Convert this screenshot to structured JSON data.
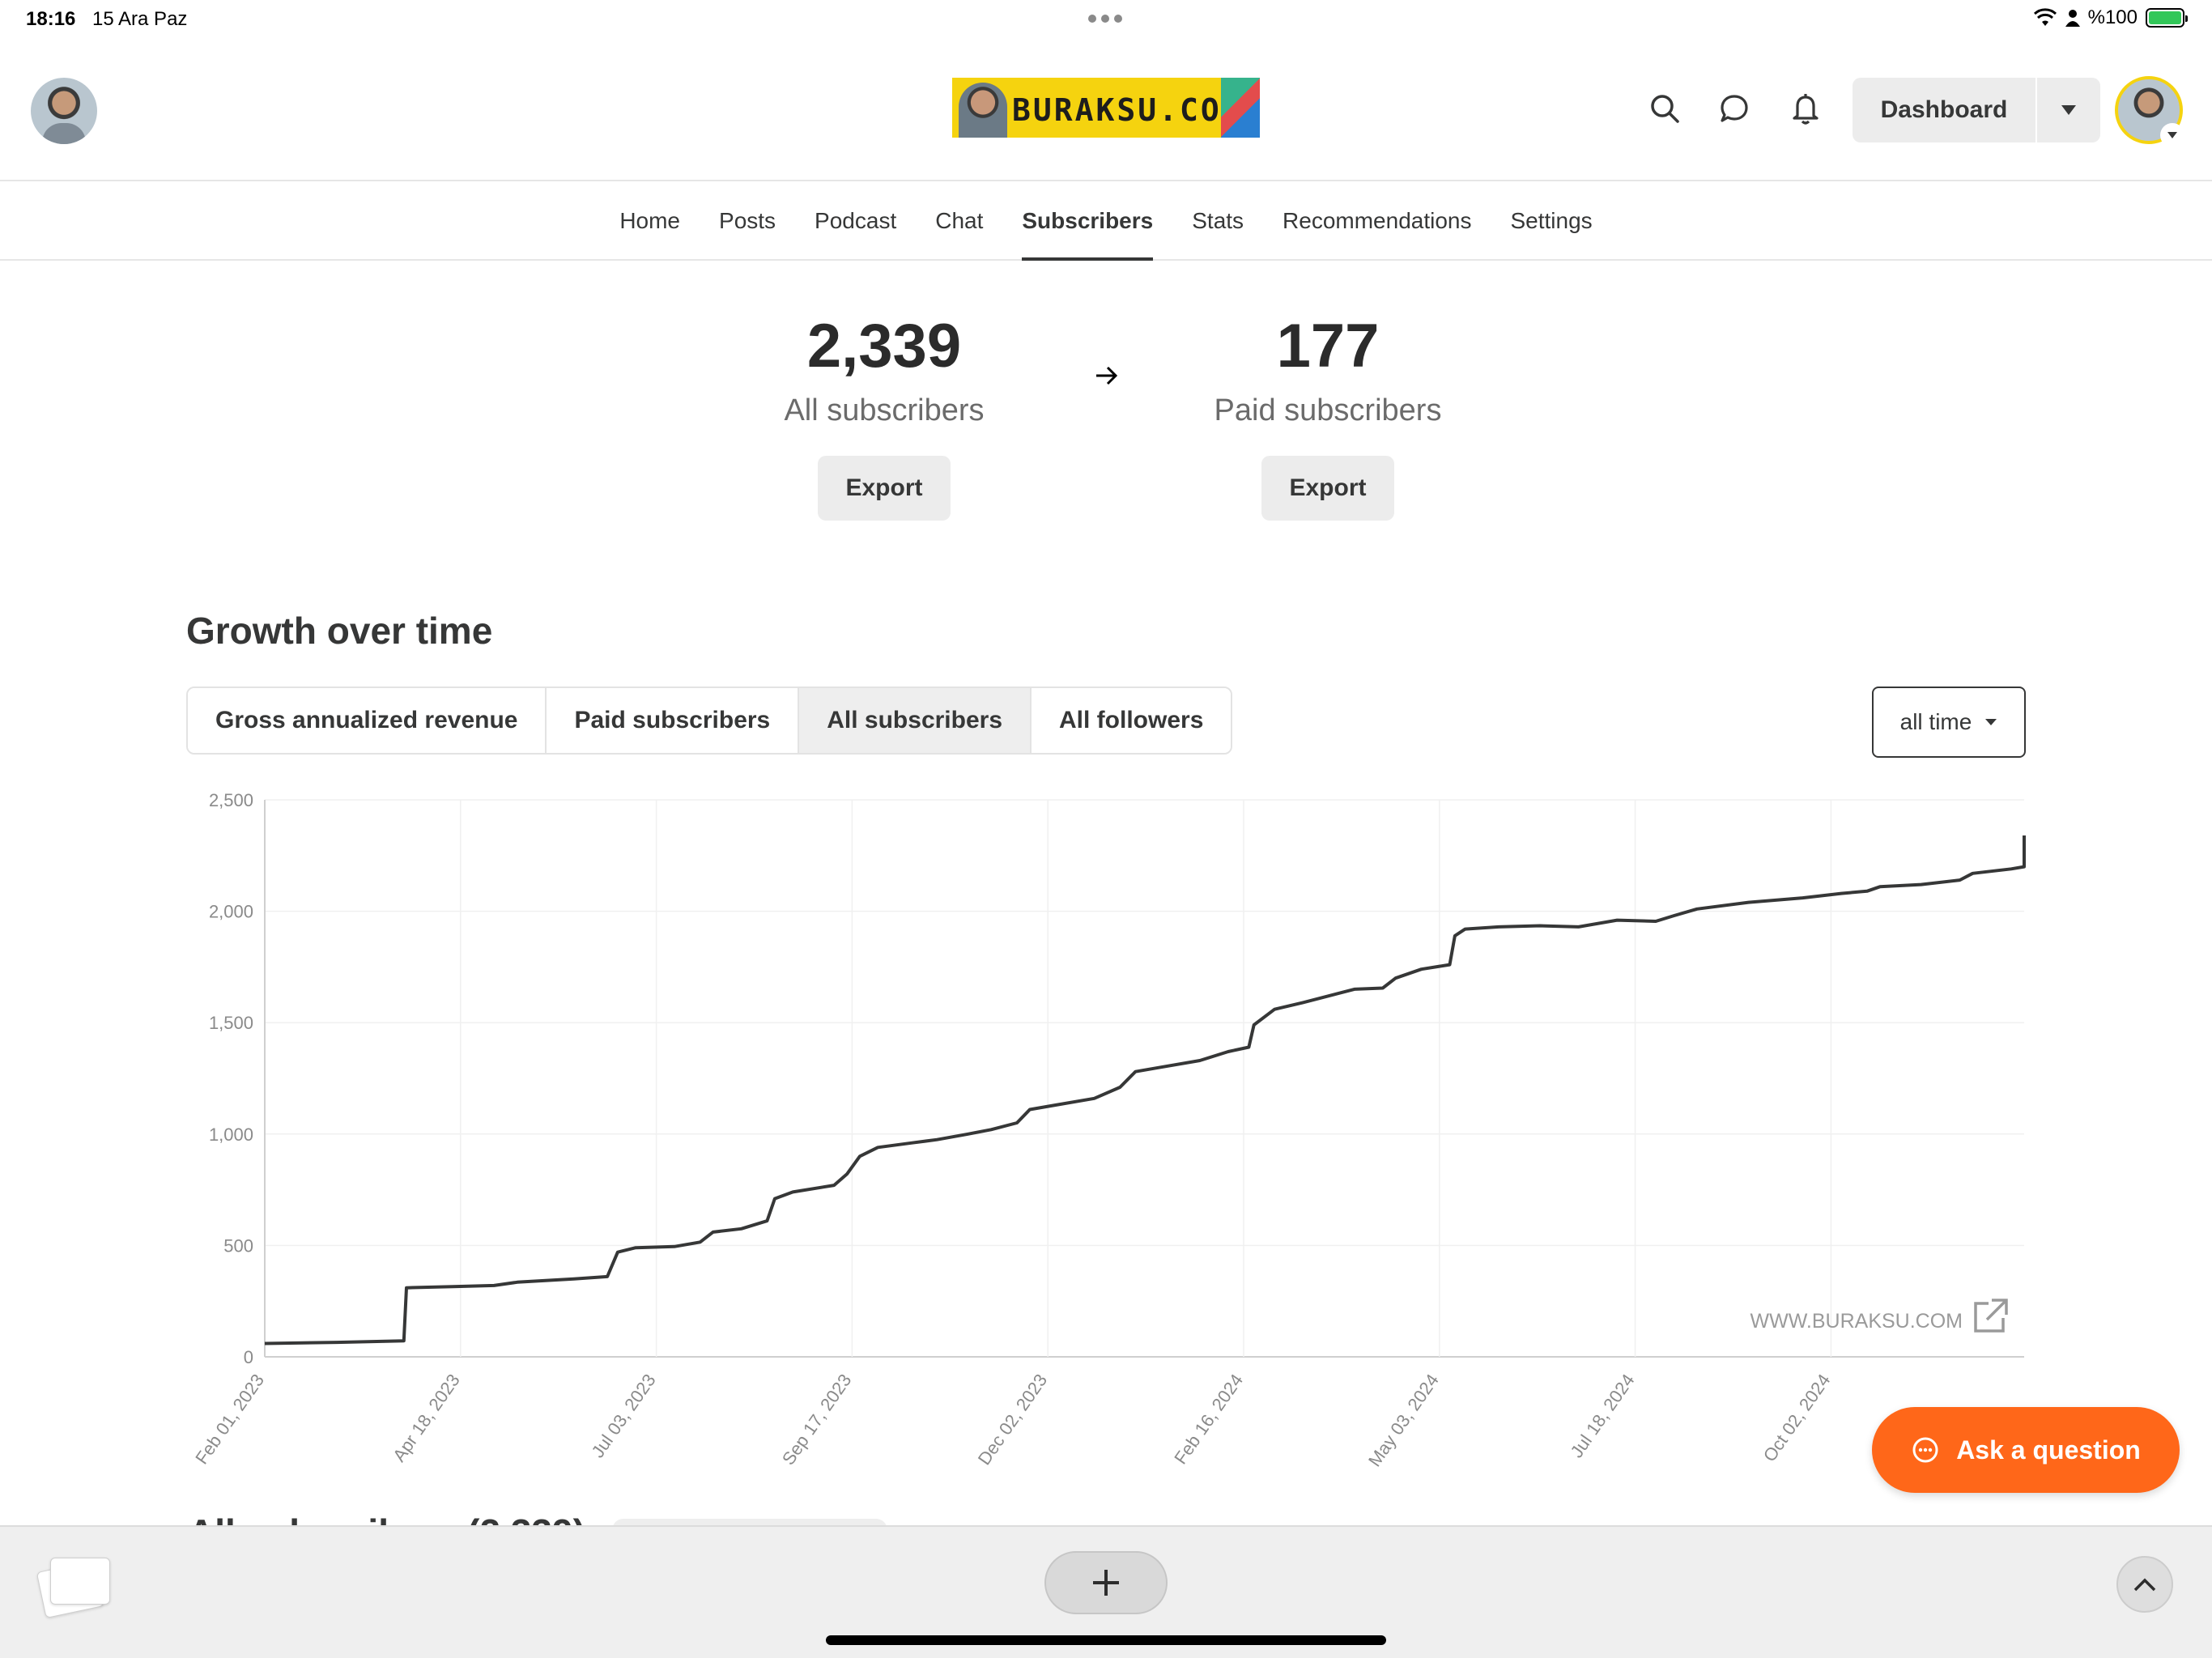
{
  "status": {
    "time": "18:16",
    "date": "15 Ara Paz",
    "battery": "%100"
  },
  "header": {
    "banner_text": "BURAKSU.COM",
    "dashboard_label": "Dashboard"
  },
  "nav": {
    "items": [
      "Home",
      "Posts",
      "Podcast",
      "Chat",
      "Subscribers",
      "Stats",
      "Recommendations",
      "Settings"
    ],
    "active": "Subscribers"
  },
  "counters": {
    "all": {
      "value": "2,339",
      "label": "All subscribers",
      "export": "Export"
    },
    "paid": {
      "value": "177",
      "label": "Paid subscribers",
      "export": "Export"
    }
  },
  "growth": {
    "title": "Growth over time",
    "tabs": [
      "Gross annualized revenue",
      "Paid subscribers",
      "All subscribers",
      "All followers"
    ],
    "active_tab": "All subscribers",
    "range": "all time"
  },
  "chart_data": {
    "type": "line",
    "ylim": [
      0,
      2500
    ],
    "yticks": [
      "0",
      "500",
      "1,000",
      "1,500",
      "2,000",
      "2,500"
    ],
    "ytick_values": [
      0,
      500,
      1000,
      1500,
      2000,
      2500
    ],
    "xticks": [
      "Feb 01, 2023",
      "Apr 18, 2023",
      "Jul 03, 2023",
      "Sep 17, 2023",
      "Dec 02, 2023",
      "Feb 16, 2024",
      "May 03, 2024",
      "Jul 18, 2024",
      "Oct 02, 2024"
    ],
    "x_start": "2023-02-01",
    "x_end": "2024-12-15",
    "watermark": "WWW.BURAKSU.COM",
    "series": [
      {
        "points": [
          [
            "2023-02-01",
            60
          ],
          [
            "2023-03-01",
            65
          ],
          [
            "2023-03-27",
            72
          ],
          [
            "2023-03-28",
            310
          ],
          [
            "2023-04-15",
            315
          ],
          [
            "2023-05-01",
            320
          ],
          [
            "2023-05-10",
            335
          ],
          [
            "2023-06-01",
            350
          ],
          [
            "2023-06-14",
            360
          ],
          [
            "2023-06-18",
            470
          ],
          [
            "2023-06-25",
            490
          ],
          [
            "2023-07-10",
            495
          ],
          [
            "2023-07-20",
            515
          ],
          [
            "2023-07-25",
            560
          ],
          [
            "2023-08-05",
            575
          ],
          [
            "2023-08-15",
            610
          ],
          [
            "2023-08-18",
            710
          ],
          [
            "2023-08-25",
            740
          ],
          [
            "2023-09-10",
            770
          ],
          [
            "2023-09-15",
            820
          ],
          [
            "2023-09-20",
            900
          ],
          [
            "2023-09-27",
            940
          ],
          [
            "2023-10-10",
            960
          ],
          [
            "2023-10-20",
            975
          ],
          [
            "2023-11-01",
            1000
          ],
          [
            "2023-11-10",
            1020
          ],
          [
            "2023-11-20",
            1050
          ],
          [
            "2023-11-25",
            1110
          ],
          [
            "2023-12-05",
            1130
          ],
          [
            "2023-12-20",
            1160
          ],
          [
            "2023-12-30",
            1210
          ],
          [
            "2024-01-05",
            1280
          ],
          [
            "2024-01-15",
            1300
          ],
          [
            "2024-01-30",
            1330
          ],
          [
            "2024-02-10",
            1370
          ],
          [
            "2024-02-18",
            1390
          ],
          [
            "2024-02-20",
            1490
          ],
          [
            "2024-02-28",
            1560
          ],
          [
            "2024-03-10",
            1590
          ],
          [
            "2024-03-20",
            1620
          ],
          [
            "2024-03-30",
            1650
          ],
          [
            "2024-04-10",
            1655
          ],
          [
            "2024-04-15",
            1700
          ],
          [
            "2024-04-25",
            1740
          ],
          [
            "2024-05-06",
            1760
          ],
          [
            "2024-05-08",
            1890
          ],
          [
            "2024-05-12",
            1920
          ],
          [
            "2024-05-25",
            1930
          ],
          [
            "2024-06-10",
            1935
          ],
          [
            "2024-06-25",
            1930
          ],
          [
            "2024-07-10",
            1960
          ],
          [
            "2024-07-25",
            1955
          ],
          [
            "2024-08-01",
            1980
          ],
          [
            "2024-08-10",
            2010
          ],
          [
            "2024-08-30",
            2040
          ],
          [
            "2024-09-20",
            2060
          ],
          [
            "2024-10-05",
            2080
          ],
          [
            "2024-10-15",
            2090
          ],
          [
            "2024-10-20",
            2110
          ],
          [
            "2024-11-05",
            2120
          ],
          [
            "2024-11-20",
            2140
          ],
          [
            "2024-11-25",
            2170
          ],
          [
            "2024-12-10",
            2190
          ],
          [
            "2025-01-05",
            2200
          ],
          [
            "2025-01-25",
            2210
          ],
          [
            "2025-02-01",
            2240
          ],
          [
            "2025-02-10",
            2290
          ],
          [
            "2025-02-25",
            2340
          ]
        ]
      }
    ]
  },
  "ask_button": "Ask a question",
  "next_section": "All subscribers (2,339)"
}
